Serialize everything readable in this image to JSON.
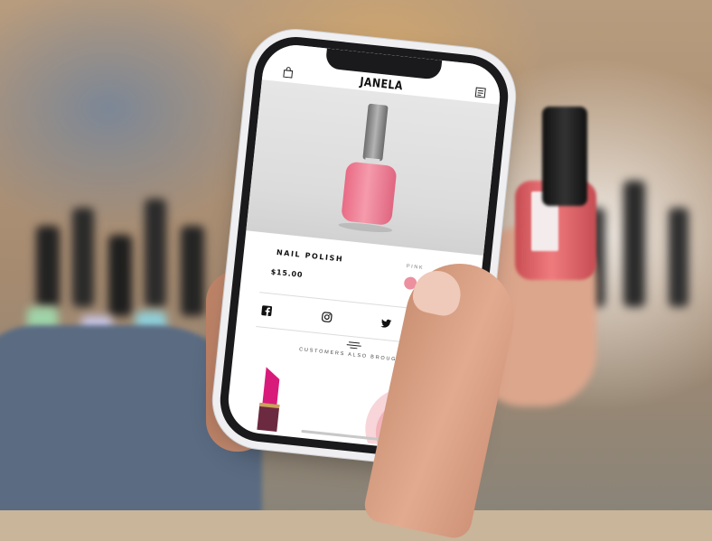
{
  "app": {
    "brand": "JANELA",
    "header": {
      "left_icon": "bag-icon",
      "right_icon": "menu-icon"
    }
  },
  "product": {
    "name": "NAIL POLISH",
    "price": "$15.00",
    "color_label": "PINK",
    "color_hex": "#ec8f9f"
  },
  "social": {
    "icons": [
      "facebook-icon",
      "instagram-icon",
      "twitter-icon",
      "whatsapp-icon"
    ]
  },
  "recommendations": {
    "title": "CUSTOMERS ALSO BROUGHT",
    "items": [
      "lipstick",
      "blush"
    ]
  },
  "colors": {
    "accent": "#ec8f9f",
    "lipstick": "#d81b7a",
    "blush": "#f2b3ba"
  }
}
